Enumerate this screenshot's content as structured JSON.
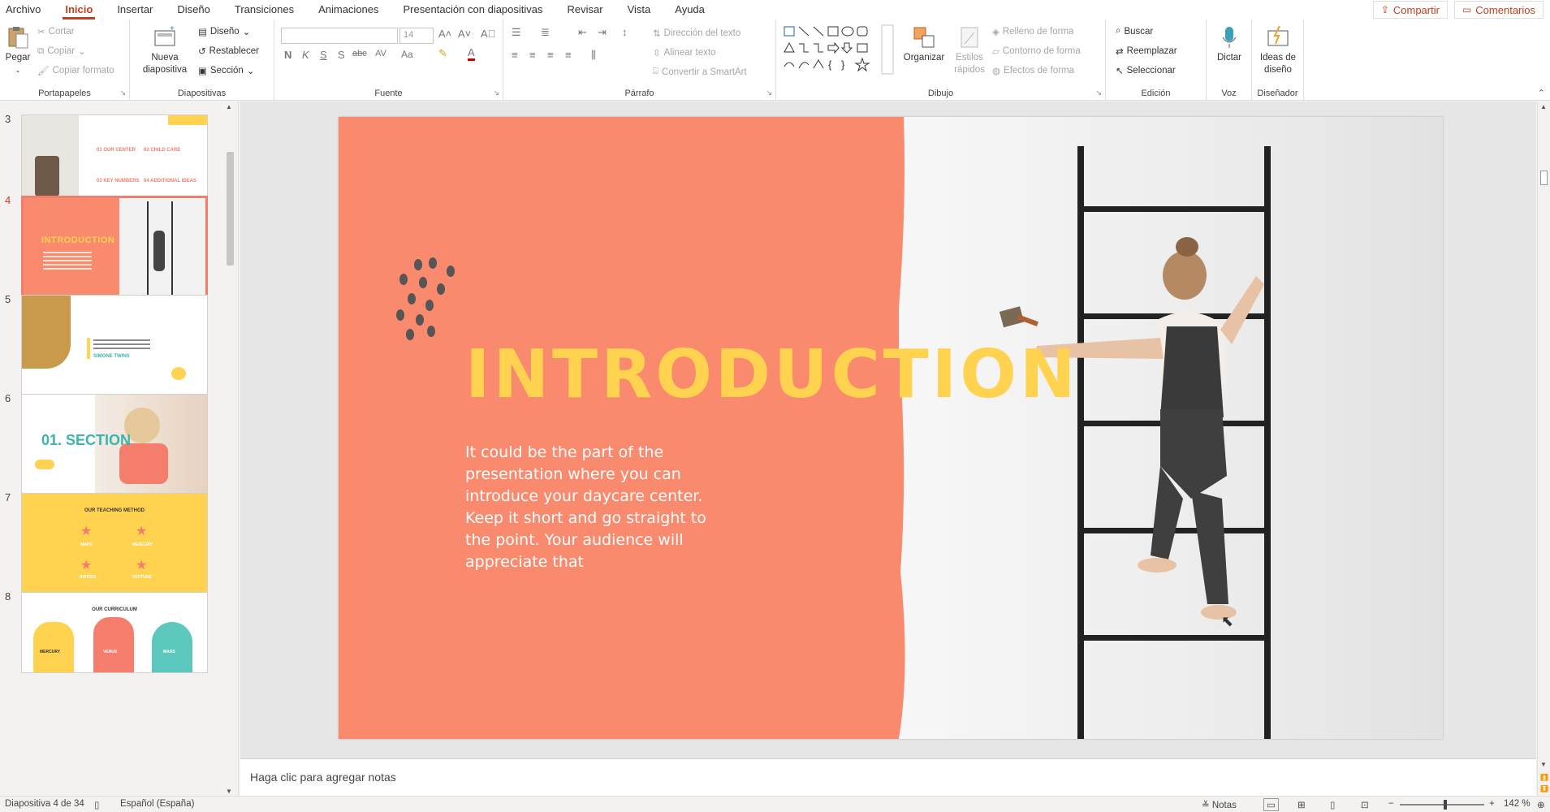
{
  "menu": {
    "tabs": [
      "Archivo",
      "Inicio",
      "Insertar",
      "Diseño",
      "Transiciones",
      "Animaciones",
      "Presentación con diapositivas",
      "Revisar",
      "Vista",
      "Ayuda"
    ],
    "active": "Inicio",
    "share": "Compartir",
    "comments": "Comentarios"
  },
  "ribbon": {
    "portapapeles": {
      "label": "Portapapeles",
      "paste": "Pegar",
      "cut": "Cortar",
      "copy": "Copiar",
      "format_painter": "Copiar formato"
    },
    "diapositivas": {
      "label": "Diapositivas",
      "new_slide_1": "Nueva",
      "new_slide_2": "diapositiva",
      "layout": "Diseño",
      "reset": "Restablecer",
      "section": "Sección"
    },
    "fuente": {
      "label": "Fuente",
      "font_name": "",
      "font_size": "14",
      "bold": "N",
      "italic": "K",
      "underline": "S",
      "shadow": "S",
      "strike": "abc",
      "spacing": "AV",
      "case": "Aa"
    },
    "parrafo": {
      "label": "Párrafo",
      "text_direction": "Dirección del texto",
      "align_text": "Alinear texto",
      "smartart": "Convertir a SmartArt"
    },
    "dibujo": {
      "label": "Dibujo",
      "arrange": "Organizar",
      "quick_styles_1": "Estilos",
      "quick_styles_2": "rápidos",
      "shape_fill": "Relleno de forma",
      "shape_outline": "Contorno de forma",
      "shape_effects": "Efectos de forma"
    },
    "edicion": {
      "label": "Edición",
      "find": "Buscar",
      "replace": "Reemplazar",
      "select": "Seleccionar"
    },
    "voz": {
      "label": "Voz",
      "dictate": "Dictar"
    },
    "disenador": {
      "label": "Diseñador",
      "ideas_1": "Ideas de",
      "ideas_2": "diseño"
    }
  },
  "thumbnails": [
    {
      "number": "3",
      "items": [
        "01 OUR CENTER",
        "02 CHILD CARE",
        "03 KEY NUMBERS",
        "04 ADDITIONAL IDEAS"
      ]
    },
    {
      "number": "4",
      "title": "INTRODUCTION"
    },
    {
      "number": "5",
      "caption": "SIMONE TWINS"
    },
    {
      "number": "6",
      "title": "01. SECTION"
    },
    {
      "number": "7",
      "title": "OUR TEACHING METHOD",
      "items": [
        "MARS",
        "MERCURY",
        "JUPITER",
        "NEPTUNE"
      ]
    },
    {
      "number": "8",
      "title": "OUR CURRICULUM",
      "items": [
        "MERCURY",
        "VENUS",
        "MARS"
      ]
    }
  ],
  "active_slide": "4",
  "slide": {
    "title": "INTRODUCTION",
    "body": "It could be the part of the presentation where you can introduce your daycare center. Keep it short and go straight to the point. Your audience will appreciate that",
    "accent_color": "#fa8a6e",
    "title_color": "#ffd24f"
  },
  "notes_placeholder": "Haga clic para agregar notas",
  "status": {
    "slide_counter": "Diapositiva 4 de 34",
    "language": "Español (España)",
    "notes": "Notas",
    "zoom": "142 %"
  }
}
